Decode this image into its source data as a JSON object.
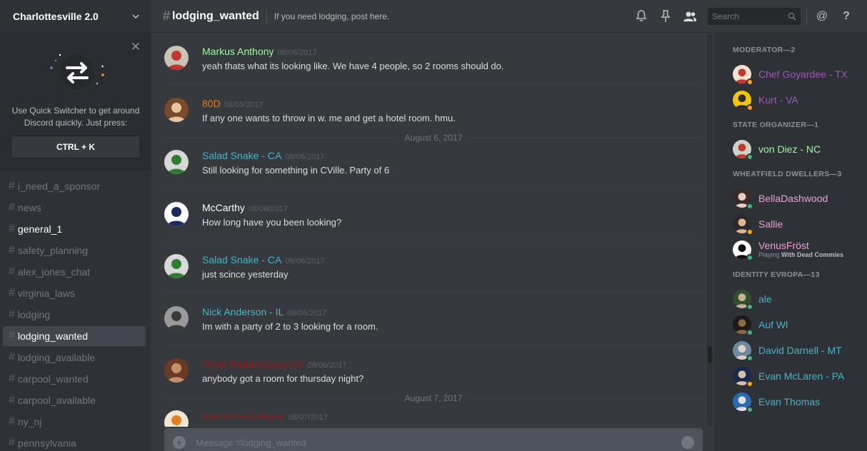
{
  "colors": {
    "online": "#43b581",
    "idle": "#faa61a",
    "moderator": "#9b59b6",
    "green_role": "#9ff5a5",
    "pink_role": "#e8a3d6",
    "teal_role": "#43b5c8"
  },
  "guild": {
    "name": "Charlottesville 2.0",
    "chevron_icon": "chevron-down-icon"
  },
  "quick_switcher": {
    "text": "Use Quick Switcher to get around Discord quickly. Just press:",
    "shortcut": "CTRL + K",
    "close_icon": "close-icon"
  },
  "channels": [
    {
      "name": "i_need_a_sponsor",
      "state": "muted"
    },
    {
      "name": "news",
      "state": "muted"
    },
    {
      "name": "general_1",
      "state": "unread"
    },
    {
      "name": "safety_planning",
      "state": "muted"
    },
    {
      "name": "alex_jones_chat",
      "state": "muted"
    },
    {
      "name": "virginia_laws",
      "state": "muted"
    },
    {
      "name": "lodging",
      "state": "muted"
    },
    {
      "name": "lodging_wanted",
      "state": "active"
    },
    {
      "name": "lodging_available",
      "state": "muted"
    },
    {
      "name": "carpool_wanted",
      "state": "muted"
    },
    {
      "name": "carpool_available",
      "state": "muted"
    },
    {
      "name": "ny_nj",
      "state": "muted"
    },
    {
      "name": "pennsylvania",
      "state": "muted"
    }
  ],
  "header": {
    "hash": "#",
    "channel": "lodging_wanted",
    "topic": "If you need lodging, post here.",
    "search_placeholder": "Search",
    "at": "@",
    "help": "?"
  },
  "messages": [
    {
      "user": "Markus Anthony",
      "color": "#9ff5a5",
      "time": "08/05/2017",
      "text": "yeah thats what its looking like.  We have 4 people, so 2 rooms should do.",
      "avatar_bg": "#c9c3b5",
      "avatar_fg": "#c0392b",
      "day_after": ""
    },
    {
      "user": "80D",
      "color": "#e67e22",
      "time": "08/05/2017",
      "text": "If any one wants to throw in w. me and get a hotel room. hmu.",
      "avatar_bg": "#7a4a2c",
      "avatar_fg": "#e8c4a0",
      "day_after": "August 6, 2017"
    },
    {
      "user": "Salad Snake - CA",
      "color": "#43b5c8",
      "time": "08/06/2017",
      "text": "Still looking for something in CVille.  Party of 6",
      "avatar_bg": "#d8d8d8",
      "avatar_fg": "#2e7d32",
      "day_after": ""
    },
    {
      "user": "McCarthy",
      "color": "#ffffff",
      "time": "08/06/2017",
      "text": "How long have you been looking?",
      "avatar_bg": "#ffffff",
      "avatar_fg": "#1d2a5c",
      "day_after": ""
    },
    {
      "user": "Salad Snake - CA",
      "color": "#43b5c8",
      "time": "08/06/2017",
      "text": "just scince yesterday",
      "avatar_bg": "#d8d8d8",
      "avatar_fg": "#2e7d32",
      "day_after": ""
    },
    {
      "user": "Nick Anderson - IL",
      "color": "#43b5c8",
      "time": "08/06/2017",
      "text": "Im with a party of 2 to 3 looking for a room.",
      "avatar_bg": "#9a9a9a",
      "avatar_fg": "#3a3a3a",
      "day_after": ""
    },
    {
      "user": "Chad Radkersburg-ND",
      "color": "#8e2020",
      "time": "08/06/2017",
      "text": "anybody got a room for thursday night?",
      "avatar_bg": "#6b3a25",
      "avatar_fg": "#c8906a",
      "day_after": "August 7, 2017"
    },
    {
      "user": "Narrative-Collapse",
      "color": "#8e2020",
      "time": "08/07/2017",
      "text": "",
      "avatar_bg": "#f0e6d2",
      "avatar_fg": "#e67e22",
      "day_after": ""
    }
  ],
  "composer": {
    "placeholder": "Message #lodging_wanted"
  },
  "member_groups": [
    {
      "title": "MODERATOR—2",
      "members": [
        {
          "name": "Chef Goyardee - TX",
          "color": "#9b59b6",
          "status": "idle",
          "playing": "",
          "game": "",
          "avatar_bg": "#f3e3d0",
          "avatar_fg": "#c0392b"
        },
        {
          "name": "Kurt - VA",
          "color": "#9b59b6",
          "status": "idle",
          "playing": "",
          "game": "",
          "avatar_bg": "#f1c40f",
          "avatar_fg": "#2c2c2c"
        }
      ]
    },
    {
      "title": "STATE ORGANIZER—1",
      "members": [
        {
          "name": "von Diez - NC",
          "color": "#9ff5a5",
          "status": "online",
          "playing": "",
          "game": "",
          "avatar_bg": "#cfcfcf",
          "avatar_fg": "#c0392b"
        }
      ]
    },
    {
      "title": "WHEATFIELD DWELLERS—3",
      "members": [
        {
          "name": "BellaDashwood",
          "color": "#e8a3d6",
          "status": "online",
          "playing": "",
          "game": "",
          "avatar_bg": "#3a2a2a",
          "avatar_fg": "#e8d0c0"
        },
        {
          "name": "Sallie",
          "color": "#e8a3d6",
          "status": "idle",
          "playing": "",
          "game": "",
          "avatar_bg": "#2a2a2a",
          "avatar_fg": "#d8b890"
        },
        {
          "name": "VenusFröst",
          "color": "#e8a3d6",
          "status": "online",
          "playing": "Playing",
          "game": "With Dead Commies",
          "avatar_bg": "#ffffff",
          "avatar_fg": "#111111"
        }
      ]
    },
    {
      "title": "IDENTITY EVROPA—13",
      "members": [
        {
          "name": "ale",
          "color": "#43b5c8",
          "status": "online",
          "playing": "",
          "game": "",
          "avatar_bg": "#2f4f2f",
          "avatar_fg": "#c8b090"
        },
        {
          "name": "Auf Wl",
          "color": "#43b5c8",
          "status": "online",
          "playing": "",
          "game": "",
          "avatar_bg": "#1a1a1a",
          "avatar_fg": "#8a6a40"
        },
        {
          "name": "David Darnell - MT",
          "color": "#43b5c8",
          "status": "online",
          "playing": "",
          "game": "",
          "avatar_bg": "#6a8aa0",
          "avatar_fg": "#e0d0c0"
        },
        {
          "name": "Evan McLaren - PA",
          "color": "#43b5c8",
          "status": "idle",
          "playing": "",
          "game": "",
          "avatar_bg": "#1a2a4a",
          "avatar_fg": "#d8c0a8"
        },
        {
          "name": "Evan Thomas",
          "color": "#43b5c8",
          "status": "online",
          "playing": "",
          "game": "",
          "avatar_bg": "#2a6ab0",
          "avatar_fg": "#e0e0e0"
        }
      ]
    }
  ]
}
